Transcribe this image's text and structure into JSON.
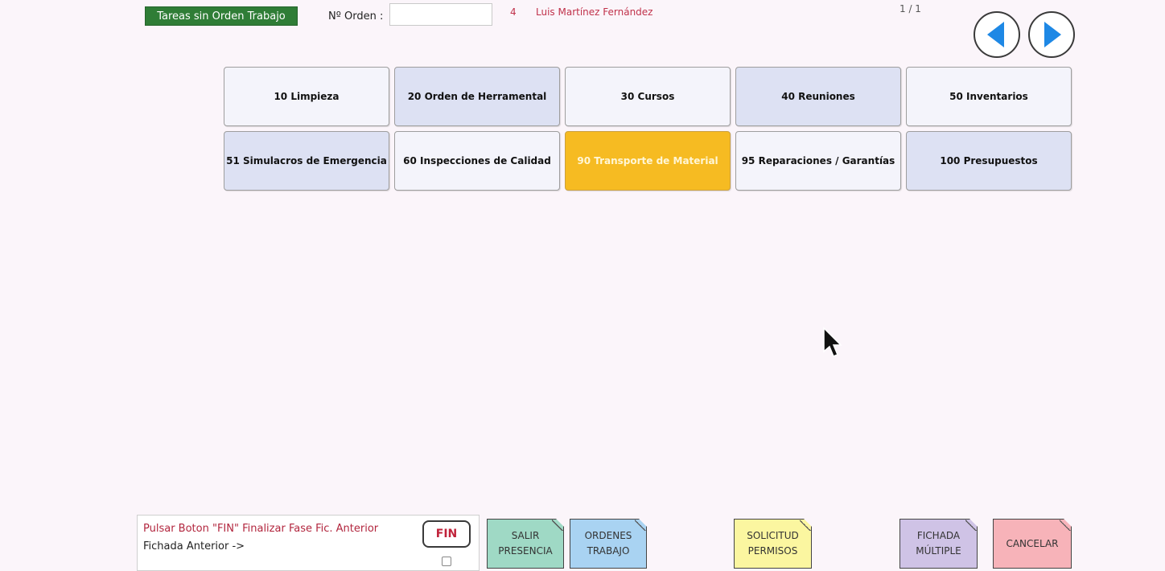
{
  "header": {
    "no_order_tasks_label": "Tareas sin Orden Trabajo",
    "order_label": "Nº Orden :",
    "order_value": "",
    "operator_number": "4",
    "operator_name": "Luis Martínez Fernández",
    "page_indicator": "1 / 1",
    "prev_icon": "triangle-left-icon",
    "next_icon": "triangle-right-icon",
    "nav_icon_color": "#1e88e5"
  },
  "tasks": [
    {
      "label": "10 Limpieza"
    },
    {
      "label": "20 Orden de Herramental"
    },
    {
      "label": "30 Cursos"
    },
    {
      "label": "40 Reuniones"
    },
    {
      "label": "50 Inventarios"
    },
    {
      "label": "51 Simulacros de Emergencia"
    },
    {
      "label": "60 Inspecciones de Calidad"
    },
    {
      "label": "90 Transporte de Material",
      "selected": true
    },
    {
      "label": "95 Reparaciones / Garantías"
    },
    {
      "label": "100 Presupuestos"
    }
  ],
  "footer": {
    "status_line1": "Pulsar Boton \"FIN\" Finalizar Fase Fic. Anterior",
    "status_line2": "Fichada Anterior ->",
    "fin_label": "FIN",
    "fin_checked": false,
    "salir_label": "SALIR\nPRESENCIA",
    "ordenes_label": "ORDENES\nTRABAJO",
    "solicitud_label": "SOLICITUD\nPERMISOS",
    "fichada_label": "FICHADA\nMÚLTIPLE",
    "cancelar_label": "CANCELAR"
  },
  "colors": {
    "accent_green": "#2f7d36",
    "selected_task": "#f6bb22",
    "operator_text": "#c0314a"
  }
}
